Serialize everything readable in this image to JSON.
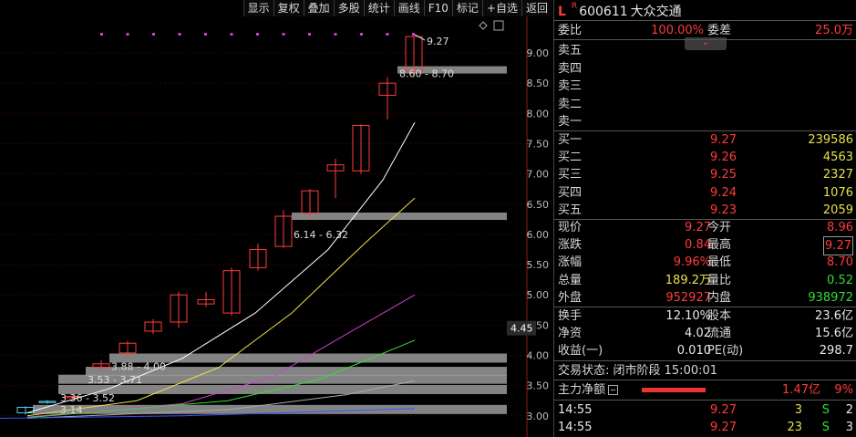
{
  "toolbar": [
    "显示",
    "复权",
    "叠加",
    "多股",
    "统计",
    "画线",
    "F10",
    "标记",
    "+自选",
    "返回"
  ],
  "chart": {
    "price_axis": [
      "9.00",
      "8.50",
      "8.00",
      "7.50",
      "7.00",
      "6.50",
      "6.00",
      "5.50",
      "5.00",
      "4.50",
      "4.00",
      "3.50",
      "3.00"
    ],
    "current_price_marker": "4.45",
    "high_label": "9.27",
    "range_labels": [
      "8.60 - 8.70",
      "6.14 - 6.32",
      "3.88 - 4.00",
      "3.53 - 3.71",
      "3.36 - 3.52",
      "3.14"
    ],
    "colors": {
      "up": "#ff3b3b",
      "ma5": "#ffffff",
      "ma10": "#e7e04a",
      "ma20": "#d040d0",
      "ma30": "#33dd33",
      "ma60": "#aaaaaa",
      "ma120": "#3355ff"
    }
  },
  "quote": {
    "flag": "L",
    "badge": "R",
    "code": "600611",
    "name": "大众交通",
    "weibi_label": "委比",
    "weibi_value": "100.00%",
    "weicha_label": "委差",
    "weicha_value": "25.0万",
    "sell": [
      {
        "label": "卖五"
      },
      {
        "label": "卖四"
      },
      {
        "label": "卖三"
      },
      {
        "label": "卖二"
      },
      {
        "label": "卖一"
      }
    ],
    "buy": [
      {
        "label": "买一",
        "price": "9.27",
        "vol": "239586"
      },
      {
        "label": "买二",
        "price": "9.26",
        "vol": "4563"
      },
      {
        "label": "买三",
        "price": "9.25",
        "vol": "2327"
      },
      {
        "label": "买四",
        "price": "9.24",
        "vol": "1076"
      },
      {
        "label": "买五",
        "price": "9.23",
        "vol": "2059"
      }
    ],
    "stats": [
      {
        "l1": "现价",
        "v1": "9.27",
        "c1": "red",
        "l2": "今开",
        "v2": "8.96",
        "c2": "red"
      },
      {
        "l1": "涨跌",
        "v1": "0.84",
        "c1": "red",
        "l2": "最高",
        "v2": "9.27",
        "c2": "red"
      },
      {
        "l1": "涨幅",
        "v1": "9.96%",
        "c1": "red",
        "l2": "最低",
        "v2": "8.70",
        "c2": "red"
      },
      {
        "l1": "总量",
        "v1": "189.2万",
        "c1": "yellow",
        "l2": "量比",
        "v2": "0.52",
        "c2": "green"
      },
      {
        "l1": "外盘",
        "v1": "952927",
        "c1": "red",
        "l2": "内盘",
        "v2": "938972",
        "c2": "green"
      }
    ],
    "stats2": [
      {
        "l1": "换手",
        "v1": "12.10%",
        "l2": "股本",
        "v2": "23.6亿"
      },
      {
        "l1": "净资",
        "v1": "4.02",
        "l2": "流通",
        "v2": "15.6亿"
      },
      {
        "l1": "收益(一)",
        "v1": "0.010",
        "l2": "PE(动)",
        "v2": "298.7"
      }
    ],
    "trade_status": "交易状态: 闭市阶段 15:00:01",
    "main_flow_label": "主力净额",
    "main_flow_value": "1.47亿",
    "main_flow_pct": "9%",
    "ticks": [
      {
        "time": "14:55",
        "price": "9.27",
        "vol": "3",
        "side": "S",
        "num": "2"
      },
      {
        "time": "14:55",
        "price": "9.27",
        "vol": "23",
        "side": "S",
        "num": "3"
      }
    ]
  }
}
